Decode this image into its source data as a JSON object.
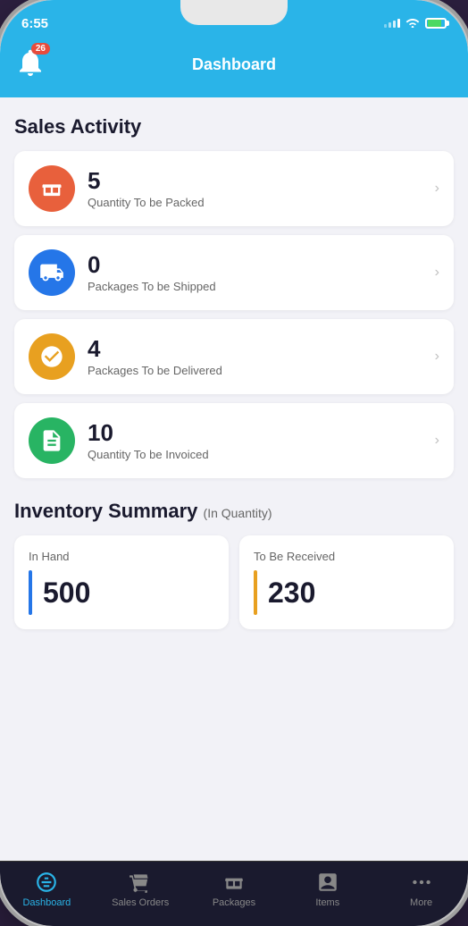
{
  "status_bar": {
    "time": "6:55",
    "notification_count": "26"
  },
  "header": {
    "title": "Dashboard"
  },
  "sales_activity": {
    "section_title": "Sales Activity",
    "items": [
      {
        "id": "packed",
        "number": "5",
        "label": "Quantity To be Packed",
        "icon_color": "#e8603c",
        "icon_type": "box"
      },
      {
        "id": "shipped",
        "number": "0",
        "label": "Packages To be Shipped",
        "icon_color": "#2576e8",
        "icon_type": "truck"
      },
      {
        "id": "delivered",
        "number": "4",
        "label": "Packages To be Delivered",
        "icon_color": "#e8a020",
        "icon_type": "check-circle"
      },
      {
        "id": "invoiced",
        "number": "10",
        "label": "Quantity To be Invoiced",
        "icon_color": "#28b463",
        "icon_type": "document"
      }
    ]
  },
  "inventory_summary": {
    "section_title": "Inventory Summary",
    "subtitle": "(In Quantity)",
    "in_hand": {
      "label": "In Hand",
      "value": "500",
      "color": "#2576e8"
    },
    "to_be_received": {
      "label": "To Be Received",
      "value": "230",
      "color": "#e8a020"
    }
  },
  "tab_bar": {
    "items": [
      {
        "id": "dashboard",
        "label": "Dashboard",
        "active": true
      },
      {
        "id": "sales-orders",
        "label": "Sales Orders",
        "active": false
      },
      {
        "id": "packages",
        "label": "Packages",
        "active": false
      },
      {
        "id": "items",
        "label": "Items",
        "active": false
      },
      {
        "id": "more",
        "label": "More",
        "active": false
      }
    ]
  }
}
